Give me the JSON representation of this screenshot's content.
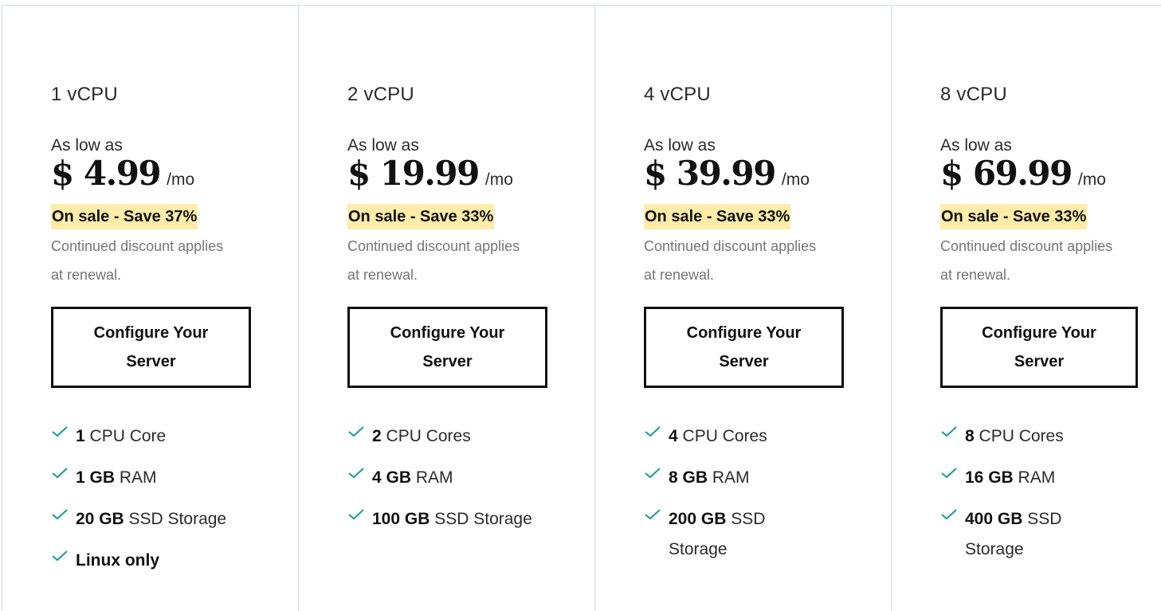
{
  "plans": [
    {
      "title": "1 vCPU",
      "as_low_as": "As low as",
      "price": "$ 4.99",
      "period": "/mo",
      "sale": "On sale - Save 37%",
      "renewal": "Continued discount applies at renewal.",
      "button": "Configure Your Server",
      "features": [
        {
          "bold": "1",
          "rest": " CPU Core"
        },
        {
          "bold": "1 GB",
          "rest": " RAM"
        },
        {
          "bold": "20 GB",
          "rest": " SSD Storage"
        },
        {
          "bold": "Linux only",
          "rest": ""
        }
      ]
    },
    {
      "title": "2 vCPU",
      "as_low_as": "As low as",
      "price": "$ 19.99",
      "period": "/mo",
      "sale": "On sale - Save 33%",
      "renewal": "Continued discount applies at renewal.",
      "button": "Configure Your Server",
      "features": [
        {
          "bold": "2",
          "rest": " CPU Cores"
        },
        {
          "bold": "4 GB",
          "rest": " RAM"
        },
        {
          "bold": "100 GB",
          "rest": " SSD Storage"
        }
      ]
    },
    {
      "title": "4 vCPU",
      "as_low_as": "As low as",
      "price": "$ 39.99",
      "period": "/mo",
      "sale": "On sale - Save 33%",
      "renewal": "Continued discount applies at renewal.",
      "button": "Configure Your Server",
      "features": [
        {
          "bold": "4",
          "rest": " CPU Cores"
        },
        {
          "bold": "8 GB",
          "rest": " RAM"
        },
        {
          "bold": "200 GB",
          "rest": " SSD Storage"
        }
      ]
    },
    {
      "title": "8 vCPU",
      "as_low_as": "As low as",
      "price": "$ 69.99",
      "period": "/mo",
      "sale": "On sale - Save 33%",
      "renewal": "Continued discount applies at renewal.",
      "button": "Configure Your Server",
      "features": [
        {
          "bold": "8",
          "rest": " CPU Cores"
        },
        {
          "bold": "16 GB",
          "rest": " RAM"
        },
        {
          "bold": "400 GB",
          "rest": " SSD Storage"
        }
      ]
    }
  ],
  "colors": {
    "check": "#1a9a9a",
    "sale_highlight": "#ffeca8",
    "divider": "#d4dbe0"
  }
}
